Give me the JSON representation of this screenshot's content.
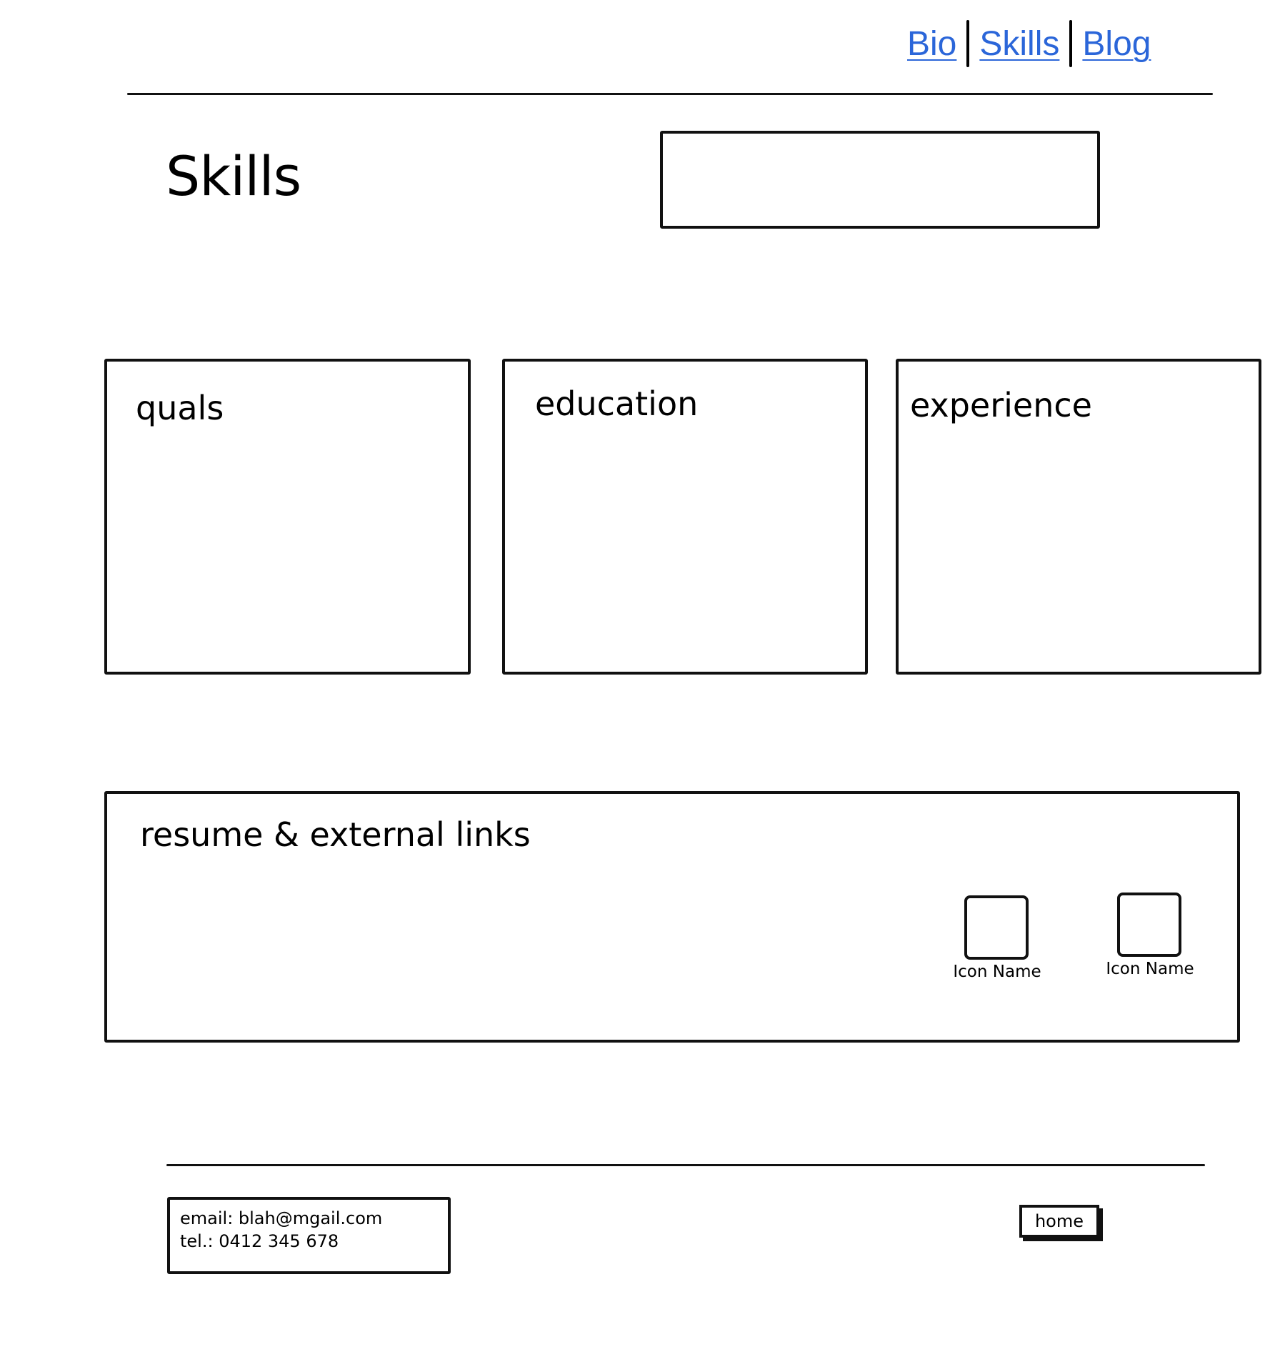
{
  "nav": {
    "items": [
      {
        "label": "Bio"
      },
      {
        "label": "Skills"
      },
      {
        "label": "Blog"
      }
    ],
    "link_color": "#2b66d9"
  },
  "page": {
    "title": "Skills"
  },
  "search": {
    "value": ""
  },
  "cards": [
    {
      "title": "quals"
    },
    {
      "title": "education"
    },
    {
      "title": "experience"
    }
  ],
  "links_panel": {
    "title": "resume & external links",
    "icons": [
      {
        "label": "Icon Name"
      },
      {
        "label": "Icon Name"
      }
    ]
  },
  "footer": {
    "email": "email: blah@mgail.com",
    "tel": "tel.: 0412 345 678",
    "home_label": "home"
  }
}
